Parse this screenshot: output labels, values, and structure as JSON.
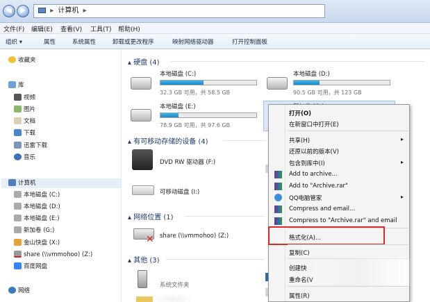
{
  "breadcrumb": {
    "path": "计算机",
    "sep": "▸"
  },
  "menubar": [
    "文件(F)",
    "编辑(E)",
    "查看(V)",
    "工具(T)",
    "帮助(H)"
  ],
  "toolbar": [
    "组织 ▾",
    "属性",
    "系统属性",
    "卸载或更改程序",
    "映射网络驱动器",
    "打开控制面板"
  ],
  "sidebar": {
    "favorites": "收藏夹",
    "library": "库",
    "libs": [
      "视频",
      "图片",
      "文档",
      "下载",
      "迅雷下载",
      "音乐"
    ],
    "computer": "计算机",
    "drives": [
      "本地磁盘 (C:)",
      "本地磁盘 (D:)",
      "本地磁盘 (E:)",
      "新加卷 (G:)",
      "金山快盘 (X:)",
      "share (\\\\vmmohoo) (Z:)",
      "百度网盘"
    ],
    "network": "网络"
  },
  "main": {
    "hdd_header": "硬盘 (4)",
    "drives": [
      {
        "label": "本地磁盘 (C:)",
        "size": "32.3 GB 可用，共 58.5 GB",
        "used": 0.45
      },
      {
        "label": "本地磁盘 (D:)",
        "size": "90.5 GB 可用，共 123 GB",
        "used": 0.27
      },
      {
        "label": "本地磁盘 (E:)",
        "size": "78.9 GB 可用，共 97.6 GB",
        "used": 0.19
      },
      {
        "label": "新加卷 (G:)",
        "size": "",
        "used": 0
      }
    ],
    "removable_header": "有可移动存储的设备 (4)",
    "removable": [
      "DVD RW 驱动器 (F:)",
      "可移动磁盘 (I:)"
    ],
    "network_header": "网络位置 (1)",
    "network_item": "share (\\\\vmmohoo) (Z:)",
    "other_header": "其他 (3)",
    "other_item": "系统文件夹"
  },
  "context_menu": {
    "open": "打开(O)",
    "open_new": "在新窗口中打开(E)",
    "share": "共享(H)",
    "restore": "还原以前的版本(V)",
    "include": "包含到库中(I)",
    "add_archive": "Add to archive...",
    "add_rar": "Add to \"Archive.rar\"",
    "qq": "QQ电脑管家",
    "compress_email": "Compress and email...",
    "compress_rar_email": "Compress to \"Archive.rar\" and email",
    "format": "格式化(A)...",
    "copy": "复制(C)",
    "shortcut": "创建快",
    "rename": "重命名(V",
    "properties": "属性(R)"
  },
  "colors": {
    "highlight": "#d62b2b",
    "accent": "#1e88c8"
  }
}
